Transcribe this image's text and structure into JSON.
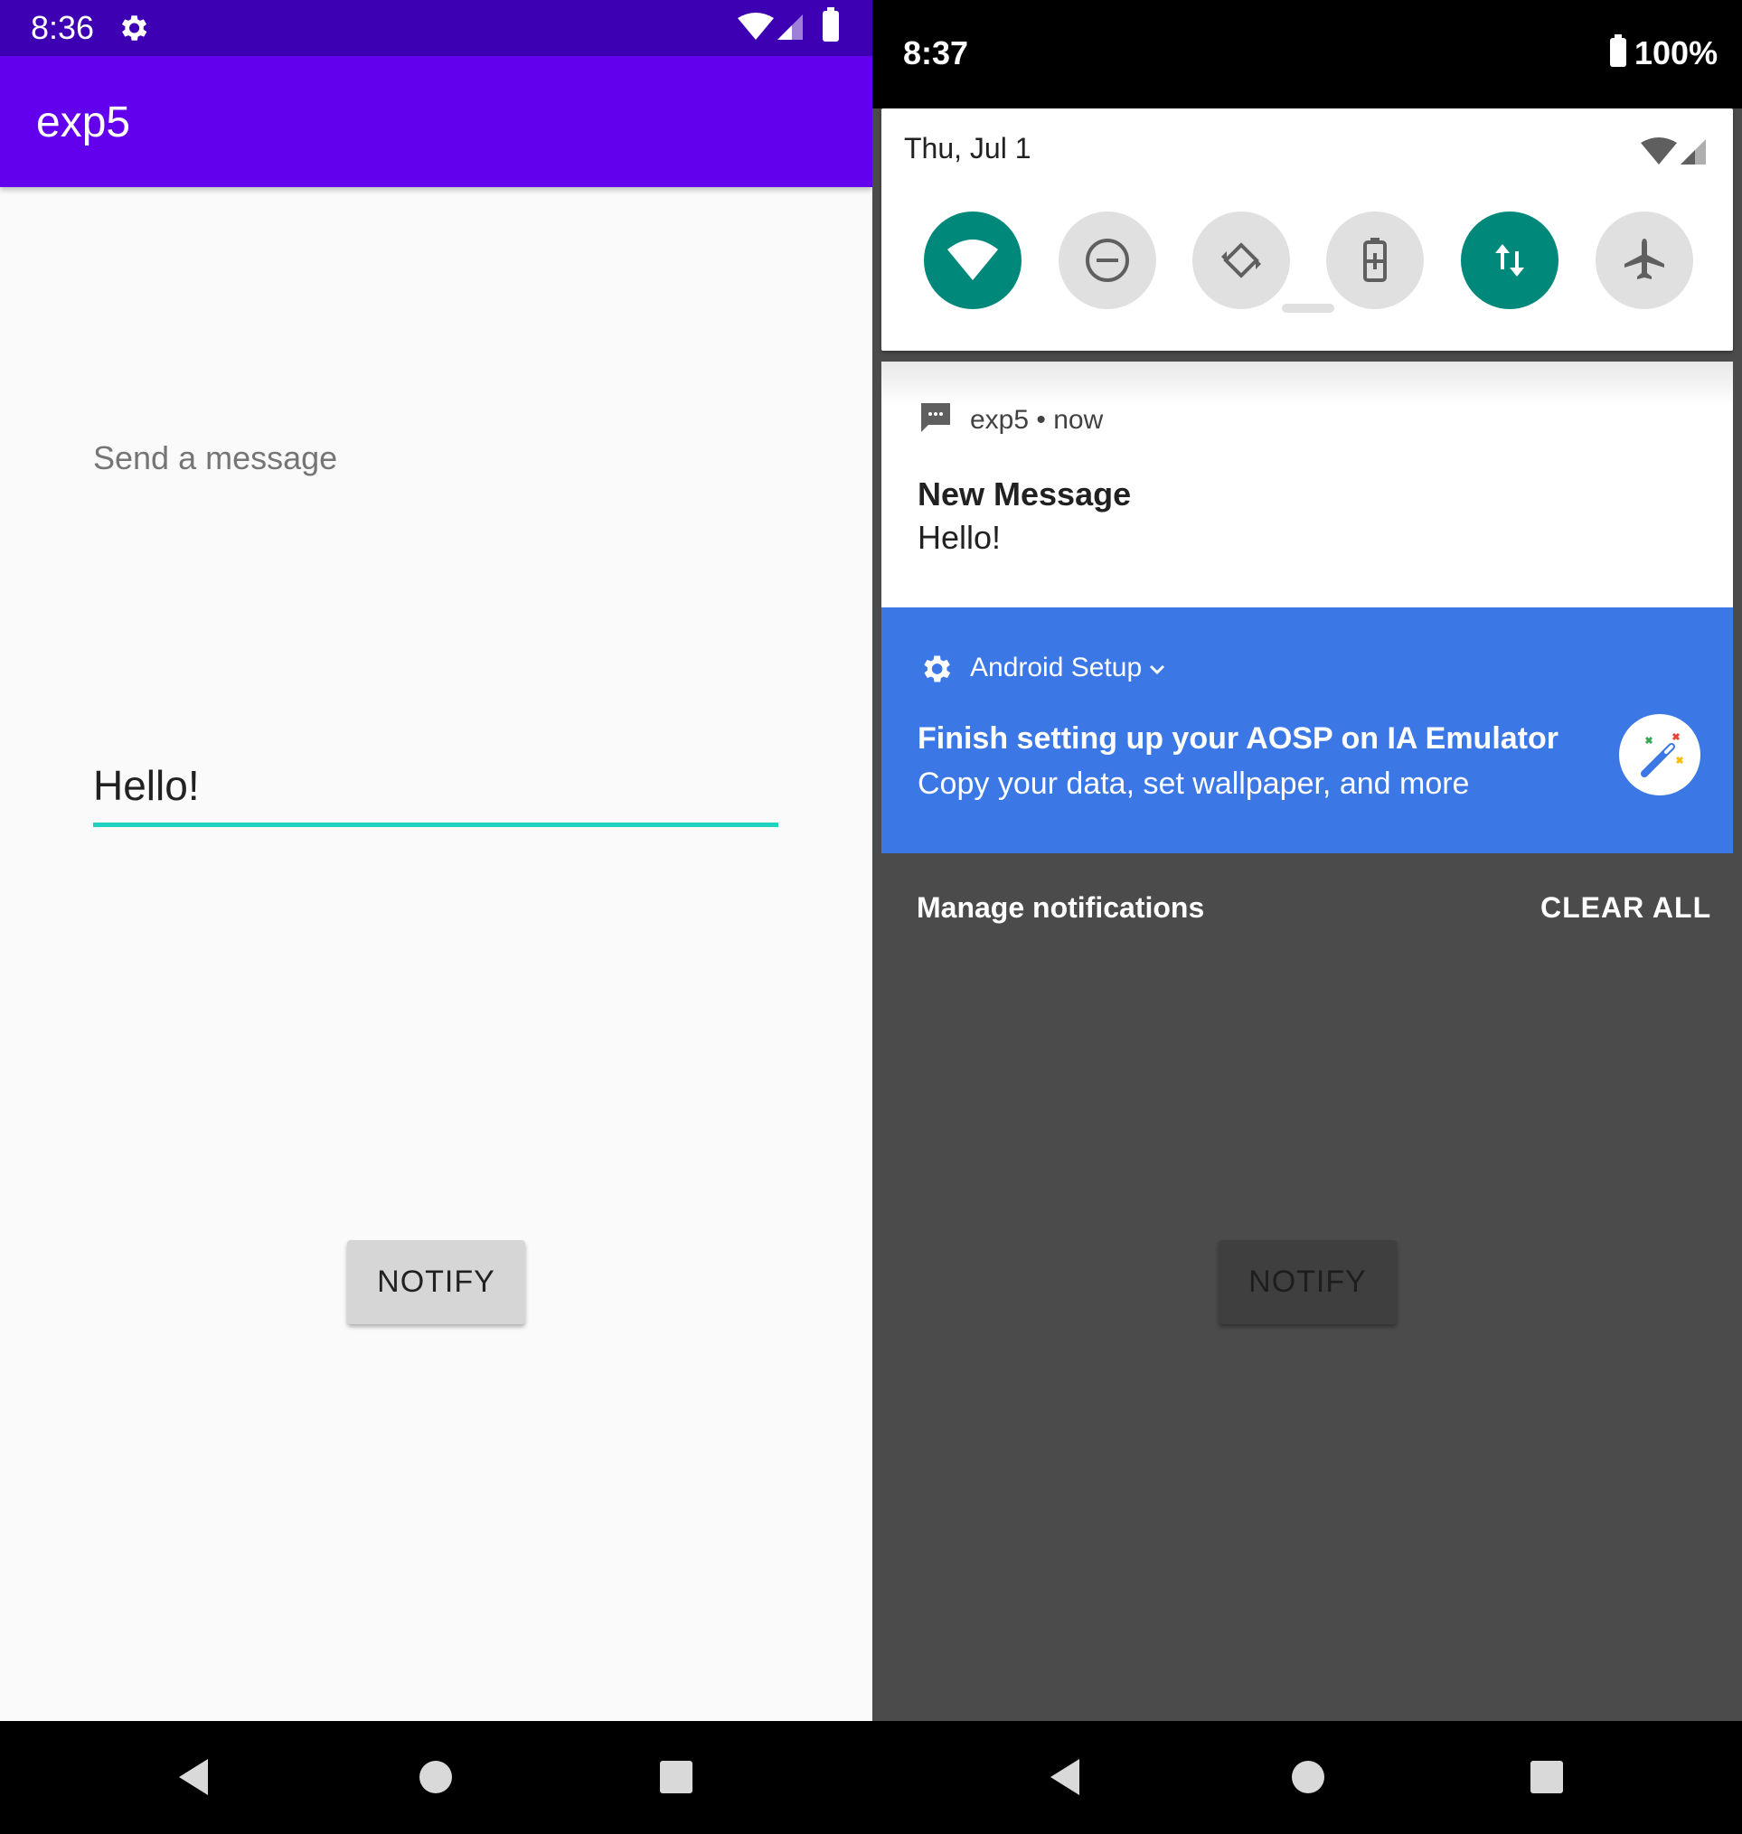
{
  "left_screen": {
    "status_bar": {
      "time": "8:36",
      "bg_color": "#3d00b2"
    },
    "app_bar": {
      "title": "exp5",
      "bg_color": "#6200ee"
    },
    "message_label": "Send a message",
    "message_input": {
      "value": "Hello!",
      "underline_color": "#1fd3bf"
    },
    "notify_button": {
      "label": "NOTIFY"
    }
  },
  "right_screen": {
    "status_bar": {
      "time": "8:37",
      "battery_percent": "100%"
    },
    "quick_settings": {
      "date": "Thu, Jul 1",
      "tiles": [
        {
          "name": "wifi-icon",
          "state": "on"
        },
        {
          "name": "do-not-disturb-icon",
          "state": "off"
        },
        {
          "name": "auto-rotate-icon",
          "state": "off"
        },
        {
          "name": "battery-saver-icon",
          "state": "off"
        },
        {
          "name": "mobile-data-icon",
          "state": "on"
        },
        {
          "name": "airplane-mode-icon",
          "state": "off"
        }
      ],
      "accent_color": "#00897b"
    },
    "notifications": [
      {
        "icon": "message-icon",
        "app": "exp5",
        "time": "now",
        "title": "New Message",
        "text": "Hello!"
      },
      {
        "icon": "gear-icon",
        "app": "Android Setup",
        "title": "Finish setting up your AOSP on IA Emulator",
        "text": "Copy your data, set wallpaper, and more",
        "bg_color": "#3b78e5"
      }
    ],
    "manage_label": "Manage notifications",
    "clear_all_label": "CLEAR ALL",
    "notify_button": {
      "label": "NOTIFY"
    }
  }
}
